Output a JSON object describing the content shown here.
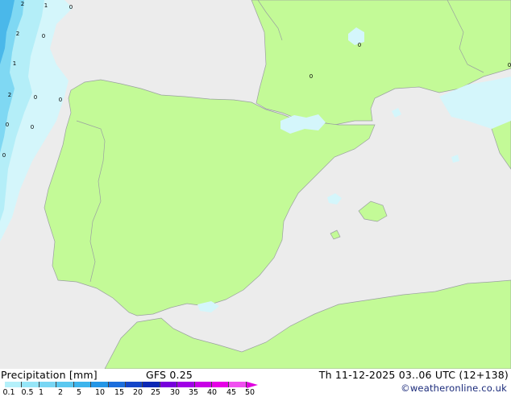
{
  "header_footer": {
    "title_left": "Precipitation [mm]",
    "model": "GFS 0.25",
    "valid_time": "Th 11-12-2025 03..06 UTC (12+138)",
    "credit": "©weatheronline.co.uk"
  },
  "legend": {
    "labels": [
      "0.1",
      "0.5",
      "1",
      "2",
      "5",
      "10",
      "15",
      "20",
      "25",
      "30",
      "35",
      "40",
      "45",
      "50"
    ],
    "colors": [
      "#b4f0fa",
      "#96e6f8",
      "#78d6f4",
      "#5ac8f0",
      "#3cb4ec",
      "#2496e6",
      "#1c6edc",
      "#1446c8",
      "#0c28b4",
      "#7800dc",
      "#a000e6",
      "#c800e6",
      "#e600e6",
      "#f050f0"
    ]
  },
  "map": {
    "land_color": "#c3fa97",
    "sea_color": "#ececec",
    "precip_light_color": "#d4f6fb",
    "precip_mid_color": "#b4eef8",
    "precip_strong_color": "#7fd8f3",
    "precip_heavy_color": "#4ab8ea",
    "sea_precip_labels": [
      "2",
      "1",
      "0",
      "2",
      "0",
      "1",
      "2",
      "0",
      "0",
      "0",
      "0",
      "0"
    ],
    "land_precip_labels": [
      "0",
      "0",
      "0"
    ]
  }
}
